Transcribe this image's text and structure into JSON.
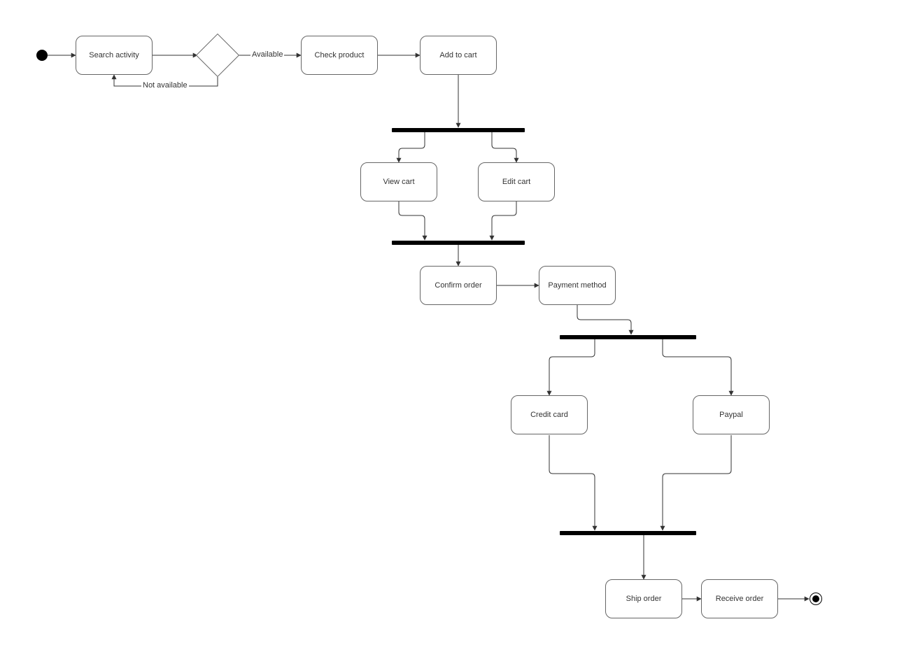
{
  "nodes": {
    "search_activity": "Search activity",
    "check_product": "Check product",
    "add_to_cart": "Add to cart",
    "view_cart": "View cart",
    "edit_cart": "Edit cart",
    "confirm_order": "Confirm order",
    "payment_method": "Payment method",
    "credit_card": "Credit card",
    "paypal": "Paypal",
    "ship_order": "Ship order",
    "receive_order": "Receive order"
  },
  "edges": {
    "available": "Available",
    "not_available": "Not available"
  }
}
